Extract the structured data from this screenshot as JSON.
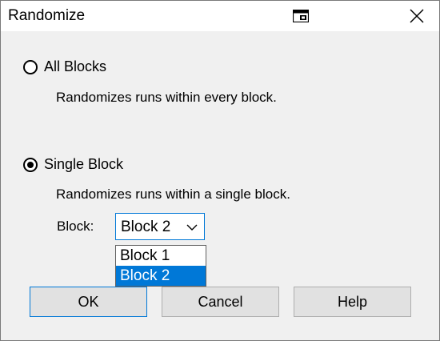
{
  "window": {
    "title": "Randomize"
  },
  "options": {
    "all_blocks": {
      "label": "All Blocks",
      "description": "Randomizes runs within every block.",
      "selected": false
    },
    "single_block": {
      "label": "Single Block",
      "description": "Randomizes runs within a single block.",
      "selected": true
    }
  },
  "block_select": {
    "label": "Block:",
    "value": "Block 2",
    "options": [
      "Block 1",
      "Block 2"
    ],
    "highlighted": "Block 2"
  },
  "buttons": {
    "ok": "OK",
    "cancel": "Cancel",
    "help": "Help"
  },
  "colors": {
    "accent": "#0078d7",
    "button_face": "#e1e1e1",
    "window_bg": "#f0f0f0"
  },
  "icons": {
    "title_help": "context-help-icon",
    "close": "close-icon",
    "dropdown": "chevron-down-icon"
  }
}
